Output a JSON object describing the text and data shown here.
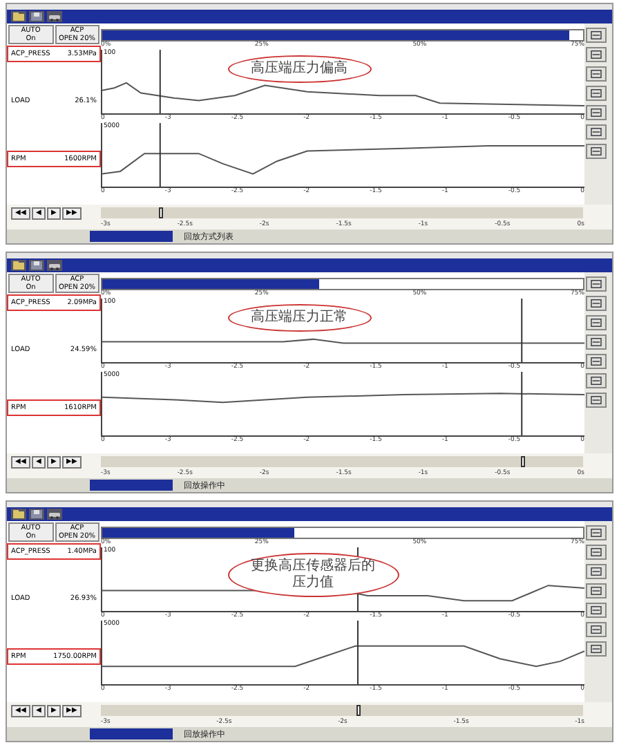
{
  "panels": [
    {
      "modes": [
        {
          "label": "AUTO",
          "value": "On"
        },
        {
          "label": "ACP",
          "value": "OPEN 20%"
        }
      ],
      "params": [
        {
          "name": "ACP_PRESS",
          "value": "3.53MPa",
          "highlighted": true
        },
        {
          "name": "LOAD",
          "value": "26.1%",
          "highlighted": false
        },
        {
          "name": "RPM",
          "value": "1600RPM",
          "highlighted": true
        }
      ],
      "record": {
        "level": 0.97,
        "ticks": [
          "0%",
          "25%",
          "50%",
          "75%"
        ]
      },
      "charts": [
        {
          "ymax": "100",
          "ymin": "0",
          "xticks": [
            "-3",
            "-2.5",
            "-2",
            "-1.5",
            "-1",
            "-0.5",
            "0"
          ]
        },
        {
          "ymax": "5000",
          "ymin": "0",
          "xticks": [
            "-3",
            "-2.5",
            "-2",
            "-1.5",
            "-1",
            "-0.5",
            "0"
          ]
        }
      ],
      "callout": "高压端压力偏高",
      "nav": [
        "◀◀",
        "◀",
        "▶",
        "▶▶"
      ],
      "playback": {
        "level": 0.12
      },
      "time_ticks": [
        "-3s",
        "-2.5s",
        "-2s",
        "-1.5s",
        "-1s",
        "-0.5s",
        "0s"
      ],
      "status": "回放方式列表"
    },
    {
      "modes": [
        {
          "label": "AUTO",
          "value": "On"
        },
        {
          "label": "ACP",
          "value": "OPEN 20%"
        }
      ],
      "params": [
        {
          "name": "ACP_PRESS",
          "value": "2.09MPa",
          "highlighted": true
        },
        {
          "name": "LOAD",
          "value": "24.59%",
          "highlighted": false
        },
        {
          "name": "RPM",
          "value": "1610RPM",
          "highlighted": true
        }
      ],
      "record": {
        "level": 0.45,
        "ticks": [
          "0%",
          "25%",
          "50%",
          "75%"
        ]
      },
      "charts": [
        {
          "ymax": "100",
          "ymin": "0",
          "xticks": [
            "-3",
            "-2.5",
            "-2",
            "-1.5",
            "-1",
            "-0.5",
            "0"
          ]
        },
        {
          "ymax": "5000",
          "ymin": "0",
          "xticks": [
            "-3",
            "-2.5",
            "-2",
            "-1.5",
            "-1",
            "-0.5",
            "0"
          ]
        }
      ],
      "callout": "高压端压力正常",
      "nav": [
        "◀◀",
        "◀",
        "▶",
        "▶▶"
      ],
      "playback": {
        "level": 0.87
      },
      "time_ticks": [
        "-3s",
        "-2.5s",
        "-2s",
        "-1.5s",
        "-1s",
        "-0.5s",
        "0s"
      ],
      "status": "回放操作中"
    },
    {
      "modes": [
        {
          "label": "AUTO",
          "value": "On"
        },
        {
          "label": "ACP",
          "value": "OPEN 20%"
        }
      ],
      "params": [
        {
          "name": "ACP_PRESS",
          "value": "1.40MPa",
          "highlighted": true
        },
        {
          "name": "LOAD",
          "value": "26.93%",
          "highlighted": false
        },
        {
          "name": "RPM",
          "value": "1750.00RPM",
          "highlighted": true
        }
      ],
      "record": {
        "level": 0.4,
        "ticks": [
          "0%",
          "25%",
          "50%",
          "75%"
        ]
      },
      "charts": [
        {
          "ymax": "100",
          "ymin": "0",
          "xticks": [
            "-3",
            "-2.5",
            "-2",
            "-1.5",
            "-1",
            "-0.5",
            "0"
          ]
        },
        {
          "ymax": "5000",
          "ymin": "0",
          "xticks": [
            "-3",
            "-2.5",
            "-2",
            "-1.5",
            "-1",
            "-0.5",
            "0"
          ]
        }
      ],
      "callout": "更换高压传感器后的压力值",
      "nav": [
        "◀◀",
        "◀",
        "▶",
        "▶▶"
      ],
      "playback": {
        "level": 0.53
      },
      "time_ticks": [
        "-3s",
        "-2.5s",
        "-2s",
        "-1.5s",
        "-1s"
      ],
      "status": "回放操作中"
    }
  ]
}
